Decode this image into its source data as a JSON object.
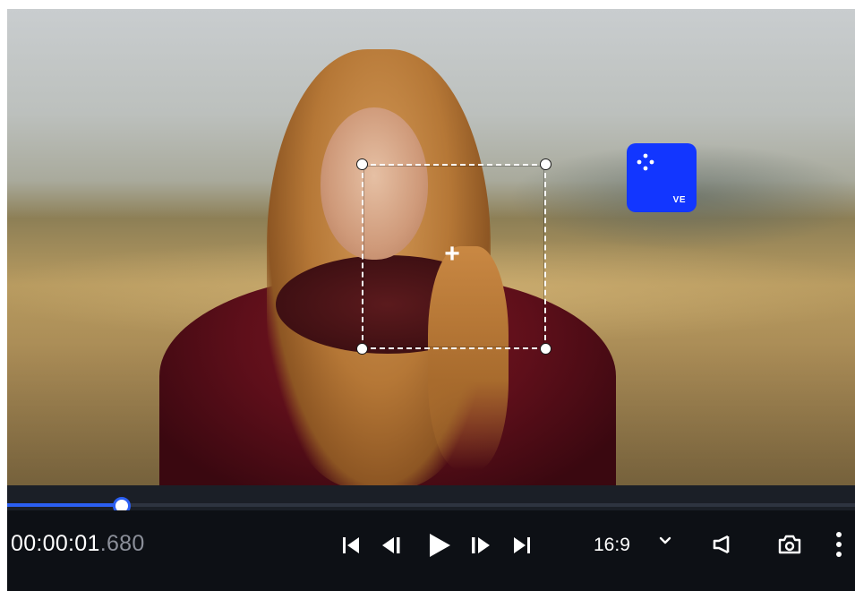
{
  "player": {
    "time_main": "00:00:01",
    "time_ms": ".680",
    "progress_percent": 13.5,
    "aspect_ratio": "16:9",
    "logo_text": "VE"
  },
  "icons": {
    "skip_start": "skip-to-start-icon",
    "frame_back": "step-back-frame-icon",
    "play": "play-icon",
    "frame_forward": "step-forward-frame-icon",
    "skip_end": "skip-to-end-icon",
    "dropdown": "chevron-down-icon",
    "volume": "speaker-icon",
    "snapshot": "camera-icon",
    "more": "more-vertical-icon"
  },
  "colors": {
    "accent": "#2b5ff2",
    "logo": "#1236ff",
    "controls_bg": "#0d1015",
    "timeline_bg": "#1b1f27"
  }
}
